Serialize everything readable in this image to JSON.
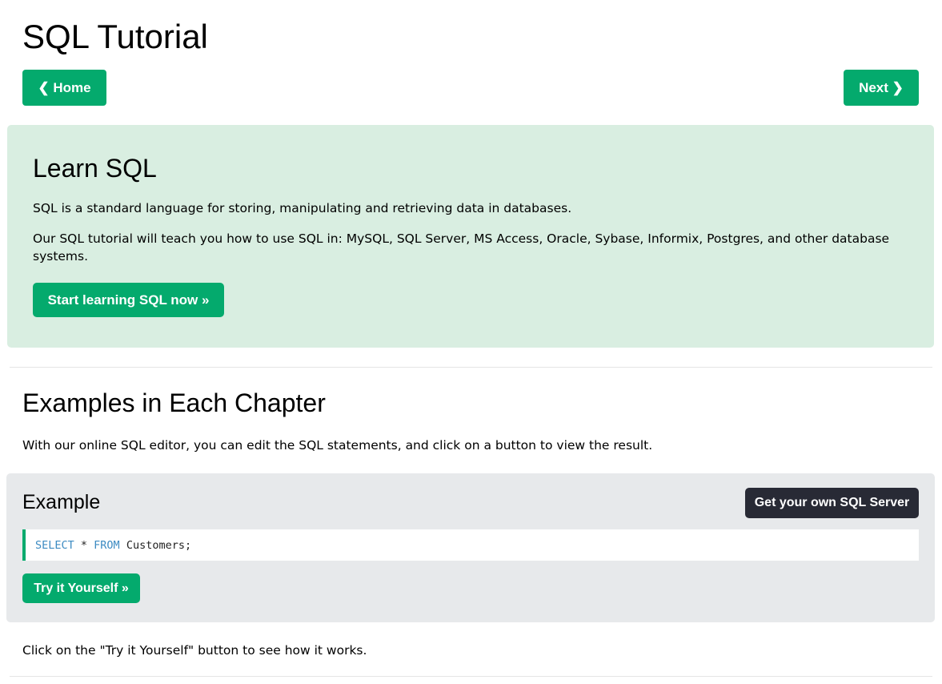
{
  "page": {
    "title": "SQL Tutorial"
  },
  "nav": {
    "home_label": "❮ Home",
    "next_label": "Next ❯"
  },
  "hero": {
    "title": "Learn SQL",
    "paragraph_1": "SQL is a standard language for storing, manipulating and retrieving data in databases.",
    "paragraph_2": "Our SQL tutorial will teach you how to use SQL in: MySQL, SQL Server, MS Access, Oracle, Sybase, Informix, Postgres, and other database systems.",
    "button_label": "Start learning SQL now »"
  },
  "examples_section": {
    "title": "Examples in Each Chapter",
    "description": "With our online SQL editor, you can edit the SQL statements, and click on a button to view the result."
  },
  "example_box": {
    "title": "Example",
    "server_button_label": "Get your own SQL Server",
    "code": {
      "keyword_select": "SELECT",
      "middle": " * ",
      "keyword_from": "FROM",
      "rest": " Customers;"
    },
    "try_button_label": "Try it Yourself »"
  },
  "footer_note": "Click on the \"Try it Yourself\" button to see how it works.",
  "colors": {
    "accent_green": "#04aa6d",
    "hero_background": "#d9eee1",
    "example_background": "#e7e9eb",
    "dark_button": "#282a35",
    "sql_keyword": "#3d8bc2"
  }
}
